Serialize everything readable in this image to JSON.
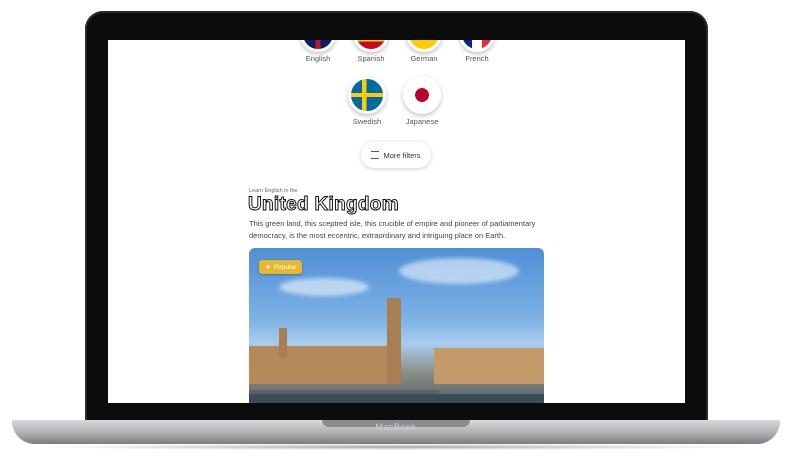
{
  "device": {
    "brand_label": "MacBook"
  },
  "languages": [
    {
      "label": "English",
      "icon": "uk-flag-icon"
    },
    {
      "label": "Spanish",
      "icon": "spain-flag-icon"
    },
    {
      "label": "German",
      "icon": "germany-flag-icon"
    },
    {
      "label": "French",
      "icon": "france-flag-icon"
    },
    {
      "label": "Swedish",
      "icon": "sweden-flag-icon"
    },
    {
      "label": "Japanese",
      "icon": "japan-flag-icon"
    }
  ],
  "filters": {
    "label": "More filters",
    "icon": "sliders-icon"
  },
  "destination": {
    "kicker": "Learn English in the",
    "title": "United Kingdom",
    "description": "This green land, this sceptred isle, this crucible of empire and pioneer of parliamentary democracy, is the most eccentric, extraordinary and intriguing place on Earth.",
    "badge": "Popular",
    "badge_icon": "star-icon"
  },
  "colors": {
    "badge": "#e6b82e",
    "laptop": "#0c0c0d"
  }
}
